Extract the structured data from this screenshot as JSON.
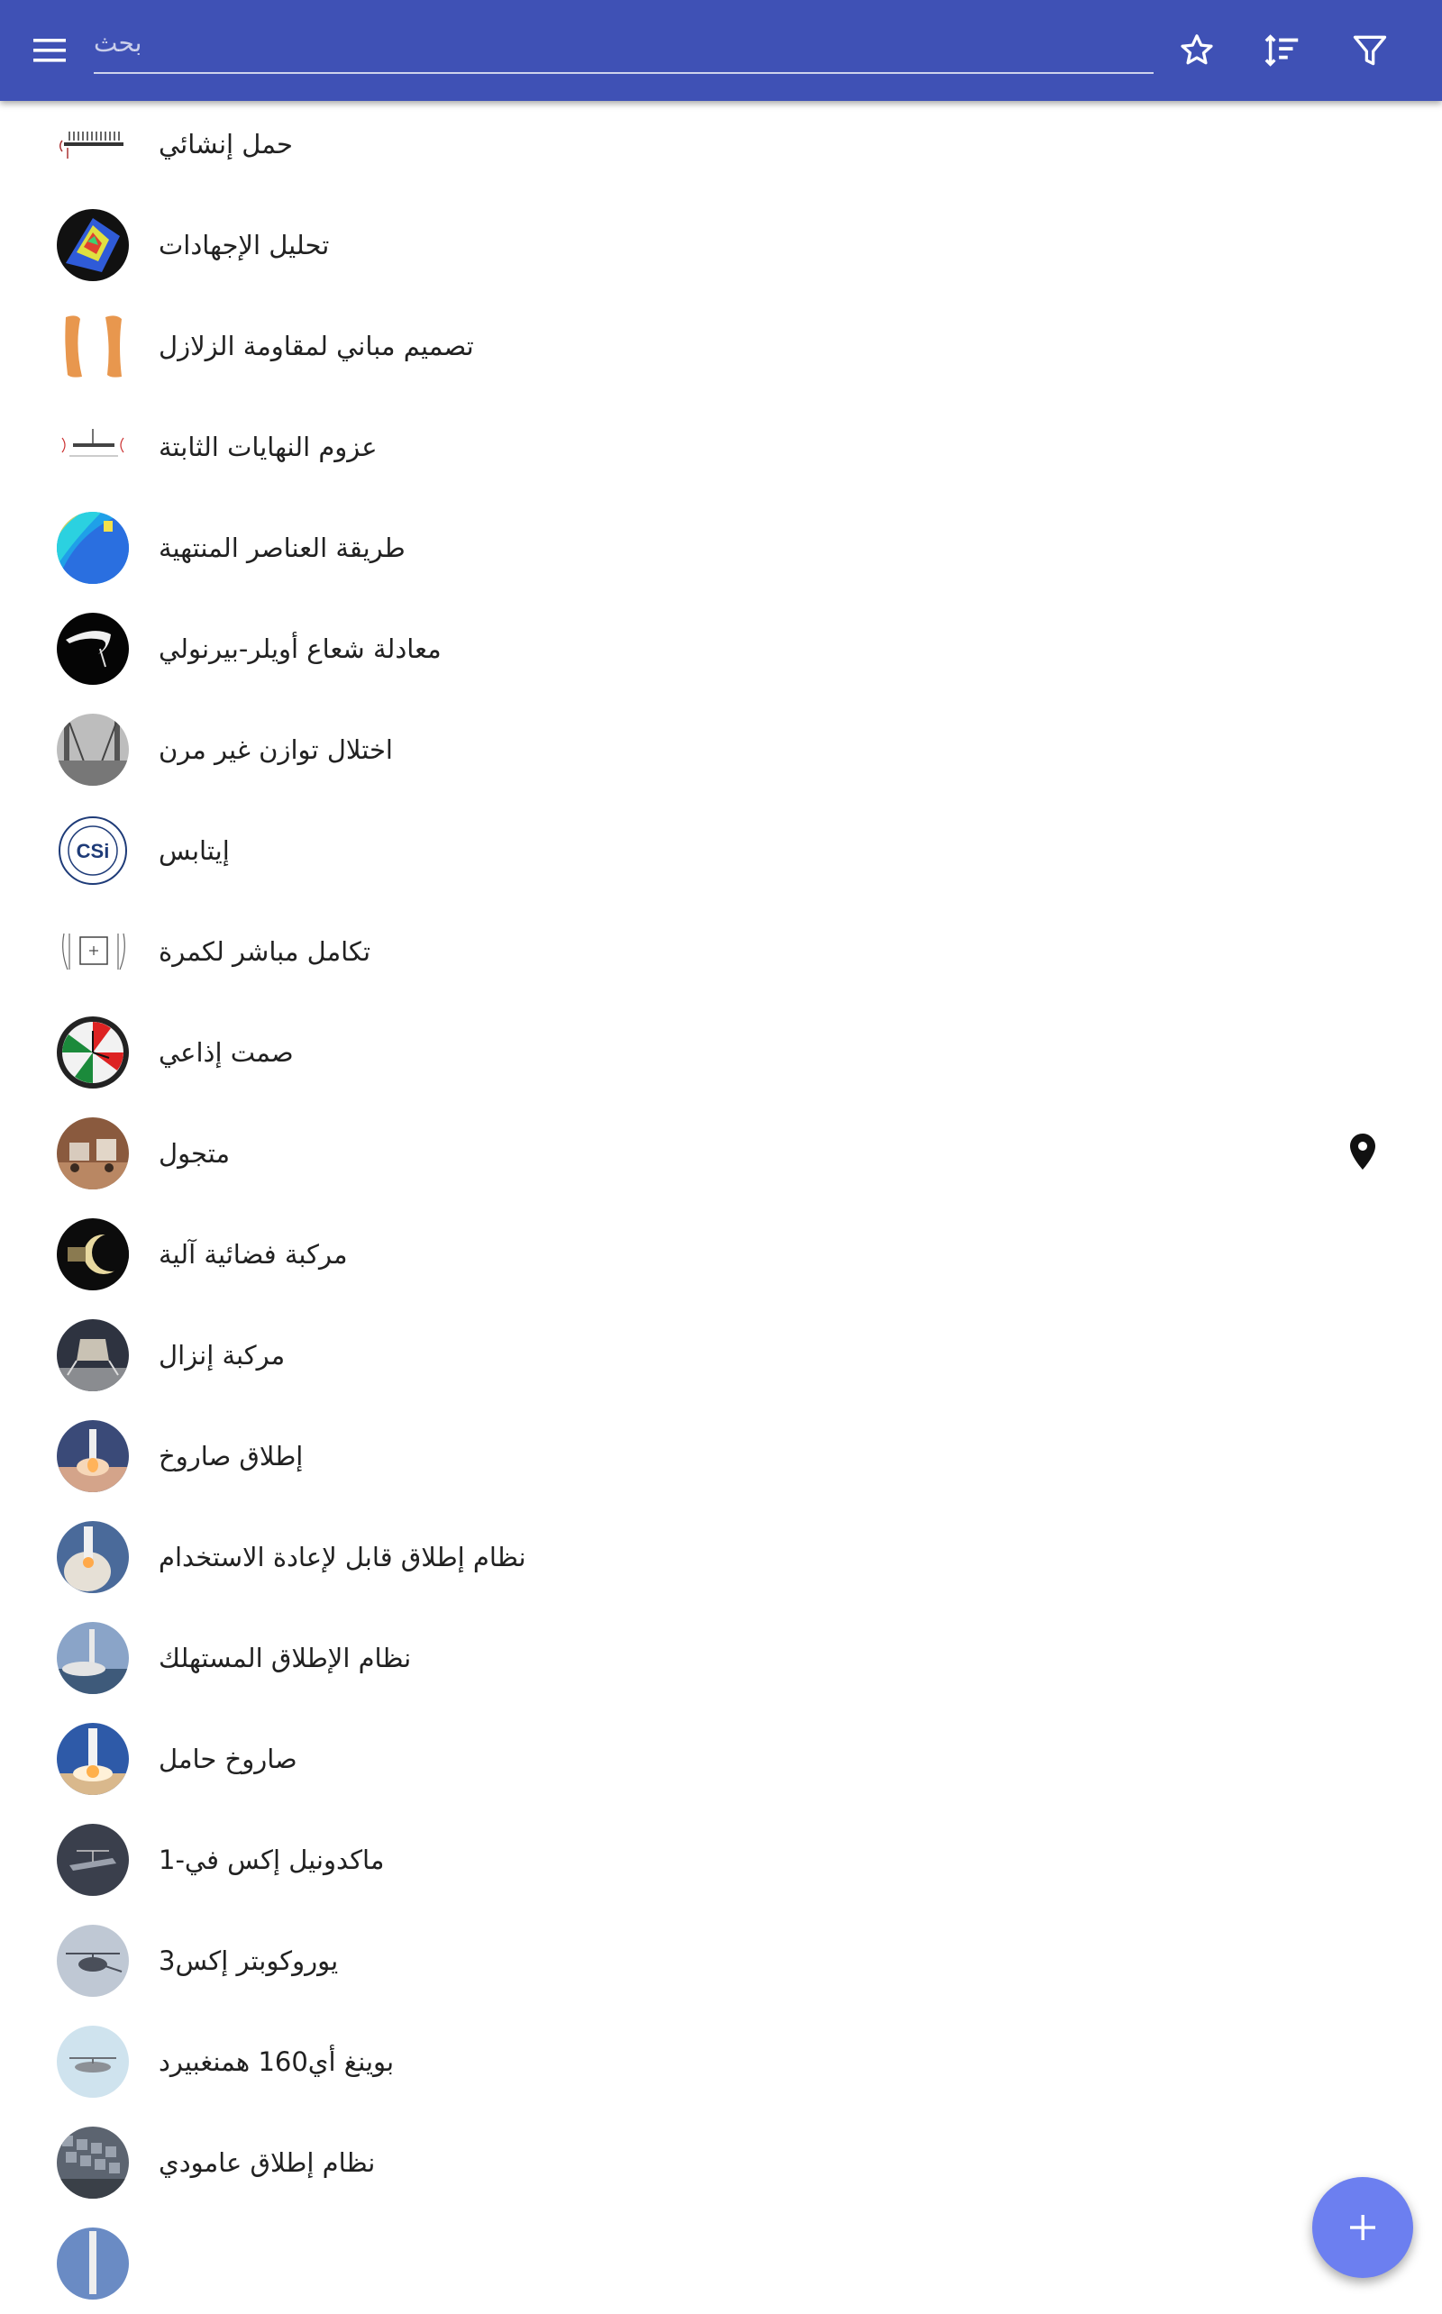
{
  "toolbar": {
    "search_placeholder": "بحث",
    "search_value": "",
    "menu_icon": "menu-icon",
    "favorite_icon": "star-outline-icon",
    "sort_icon": "sort-icon",
    "filter_icon": "filter-icon",
    "color": "#3f51b5"
  },
  "list": {
    "items": [
      {
        "title": "حمل إنشائي",
        "thumbnail": "load-diagram-thumbnail"
      },
      {
        "title": "تحليل الإجهادات",
        "thumbnail": "stress-analysis-thumbnail"
      },
      {
        "title": "تصميم مباني لمقاومة الزلازل",
        "thumbnail": "earthquake-design-thumbnail"
      },
      {
        "title": "عزوم النهايات الثابتة",
        "thumbnail": "fixed-end-moments-thumbnail"
      },
      {
        "title": "طريقة العناصر المنتهية",
        "thumbnail": "finite-element-thumbnail"
      },
      {
        "title": "معادلة شعاع أويلر-بيرنولي",
        "thumbnail": "beam-equation-thumbnail"
      },
      {
        "title": "اختلال توازن غير مرن",
        "thumbnail": "bridge-thumbnail"
      },
      {
        "title": "إيتابس",
        "thumbnail": "csi-logo-thumbnail"
      },
      {
        "title": "تكامل مباشر لكمرة",
        "thumbnail": "beam-integration-thumbnail"
      },
      {
        "title": "صمت إذاعي",
        "thumbnail": "radio-clock-thumbnail"
      },
      {
        "title": "متجول",
        "thumbnail": "rover-thumbnail",
        "has_location": true
      },
      {
        "title": "مركبة فضائية آلية",
        "thumbnail": "space-probe-thumbnail"
      },
      {
        "title": "مركبة إنزال",
        "thumbnail": "lander-thumbnail"
      },
      {
        "title": "إطلاق صاروخ",
        "thumbnail": "rocket-launch-thumbnail"
      },
      {
        "title": "نظام إطلاق قابل لإعادة الاستخدام",
        "thumbnail": "shuttle-launch-thumbnail"
      },
      {
        "title": "نظام الإطلاق المستهلك",
        "thumbnail": "expendable-launch-thumbnail"
      },
      {
        "title": "صاروخ حامل",
        "thumbnail": "carrier-rocket-thumbnail"
      },
      {
        "title": "ماكدونيل إكس في-1",
        "thumbnail": "xv1-aircraft-thumbnail"
      },
      {
        "title": "يوروكوبتر إكس3",
        "thumbnail": "eurocopter-thumbnail"
      },
      {
        "title": "بوينغ أي160 همنغبيرد",
        "thumbnail": "hummingbird-drone-thumbnail"
      },
      {
        "title": "نظام إطلاق عامودي",
        "thumbnail": "vertical-launch-thumbnail"
      },
      {
        "title": "",
        "thumbnail": "next-item-thumbnail"
      }
    ]
  },
  "fab": {
    "icon": "plus-icon",
    "color": "#6c7ff0"
  }
}
